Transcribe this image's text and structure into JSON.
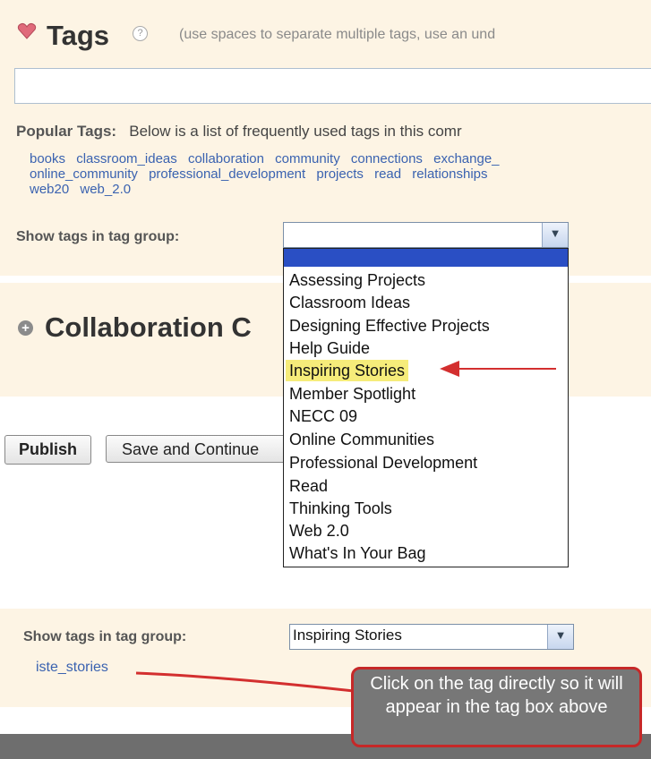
{
  "tags_section": {
    "title": "Tags",
    "help_icon": "?",
    "hint": "(use spaces to separate multiple tags, use an und",
    "input_value": "",
    "popular_label": "Popular Tags:",
    "popular_description": "Below is a list of frequently used tags in this comr",
    "tag_rows": [
      [
        "books",
        "classroom_ideas",
        "collaboration",
        "community",
        "connections",
        "exchange_"
      ],
      [
        "online_community",
        "professional_development",
        "projects",
        "read",
        "relationships"
      ],
      [
        "web20",
        "web_2.0"
      ]
    ],
    "group_label": "Show tags in tag group:",
    "group_selected": ""
  },
  "dropdown": {
    "options": [
      "Assessing Projects",
      "Classroom Ideas",
      "Designing Effective Projects",
      "Help Guide",
      "Inspiring Stories",
      "Member Spotlight",
      "NECC 09",
      "Online Communities",
      "Professional Development",
      "Read",
      "Thinking Tools",
      "Web 2.0",
      "What's In Your Bag"
    ],
    "highlighted": "Inspiring Stories"
  },
  "collaboration": {
    "icon": "+",
    "title": "Collaboration C"
  },
  "actions": {
    "publish": "Publish",
    "save_continue": "Save and Continue"
  },
  "lower": {
    "group_label": "Show tags in tag group:",
    "group_selected": "Inspiring Stories",
    "tag": "iste_stories",
    "callout": "Click on the tag directly so it will appear in the tag box above"
  },
  "icons": {
    "tag": "tag-icon",
    "help": "help-icon",
    "expand": "plus-circle-icon",
    "dropdown": "chevron-down-icon"
  },
  "colors": {
    "panel_bg": "#fdf4e4",
    "link": "#3a62b0",
    "highlight": "#f6ec7a",
    "arrow": "#d32f2f",
    "selected": "#2a4fc4"
  }
}
